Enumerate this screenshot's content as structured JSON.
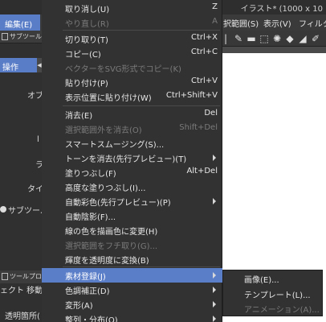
{
  "window": {
    "title": "イラスト* (1000 x 10"
  },
  "menubar": {
    "edit": "編集(E)",
    "selection": "択範囲(S)",
    "view": "表示(V)",
    "filter": "フィルタ"
  },
  "left_panel": {
    "subtool_header": "サブツール[移",
    "operation_tab": "操作",
    "operation_fragment": "オブ",
    "fragment_1": "l",
    "fragment_2": "ラ",
    "fragment_3": "タイ",
    "subtool_label": "サブツールを",
    "tool_property_header": "ツールプロパ",
    "effect_label": "ェクト 移動",
    "transparency_label": "透明箇所("
  },
  "edit_menu": {
    "items": [
      {
        "label": "取り消し(U)",
        "shortcut": "Z",
        "disabled": false
      },
      {
        "label": "やり直し(R)",
        "shortcut": "A",
        "disabled": true
      },
      {
        "label": "切り取り(T)",
        "shortcut": "Ctrl+X",
        "disabled": false
      },
      {
        "label": "コピー(C)",
        "shortcut": "Ctrl+C",
        "disabled": false
      },
      {
        "label": "ベクターをSVG形式でコピー(K)",
        "shortcut": "",
        "disabled": true
      },
      {
        "label": "貼り付け(P)",
        "shortcut": "Ctrl+V",
        "disabled": false
      },
      {
        "label": "表示位置に貼り付け(W)",
        "shortcut": "Ctrl+Shift+V",
        "disabled": false
      },
      {
        "label": "消去(E)",
        "shortcut": "Del",
        "disabled": false
      },
      {
        "label": "選択範囲外を消去(O)",
        "shortcut": "Shift+Del",
        "disabled": true
      },
      {
        "label": "スマートスムージング(S)...",
        "shortcut": "",
        "disabled": false
      },
      {
        "label": "トーンを消去(先行プレビュー)(T)",
        "shortcut": "",
        "disabled": false
      },
      {
        "label": "塗りつぶし(F)",
        "shortcut": "Alt+Del",
        "disabled": false
      },
      {
        "label": "高度な塗りつぶし(I)...",
        "shortcut": "",
        "disabled": false
      },
      {
        "label": "自動彩色(先行プレビュー)(P)",
        "shortcut": "",
        "disabled": false
      },
      {
        "label": "自動陰影(F)...",
        "shortcut": "",
        "disabled": false
      },
      {
        "label": "線の色を描画色に変更(H)",
        "shortcut": "",
        "disabled": false
      },
      {
        "label": "選択範囲をフチ取り(G)...",
        "shortcut": "",
        "disabled": true
      },
      {
        "label": "輝度を透明度に変換(B)",
        "shortcut": "",
        "disabled": false
      },
      {
        "label": "素材登録(J)",
        "shortcut": "",
        "disabled": false
      },
      {
        "label": "色調補正(D)",
        "shortcut": "",
        "disabled": false
      },
      {
        "label": "変形(A)",
        "shortcut": "",
        "disabled": false
      },
      {
        "label": "整列・分布(Q)",
        "shortcut": "",
        "disabled": false
      }
    ]
  },
  "material_submenu": {
    "items": [
      {
        "label": "画像(E)...",
        "disabled": false
      },
      {
        "label": "テンプレート(L)...",
        "disabled": false
      },
      {
        "label": "アニメーション(A)...",
        "disabled": true
      }
    ]
  },
  "colors": {
    "highlight": "#5b7ec9",
    "menu_bg": "#323232",
    "disabled_text": "#7a7a7a"
  }
}
